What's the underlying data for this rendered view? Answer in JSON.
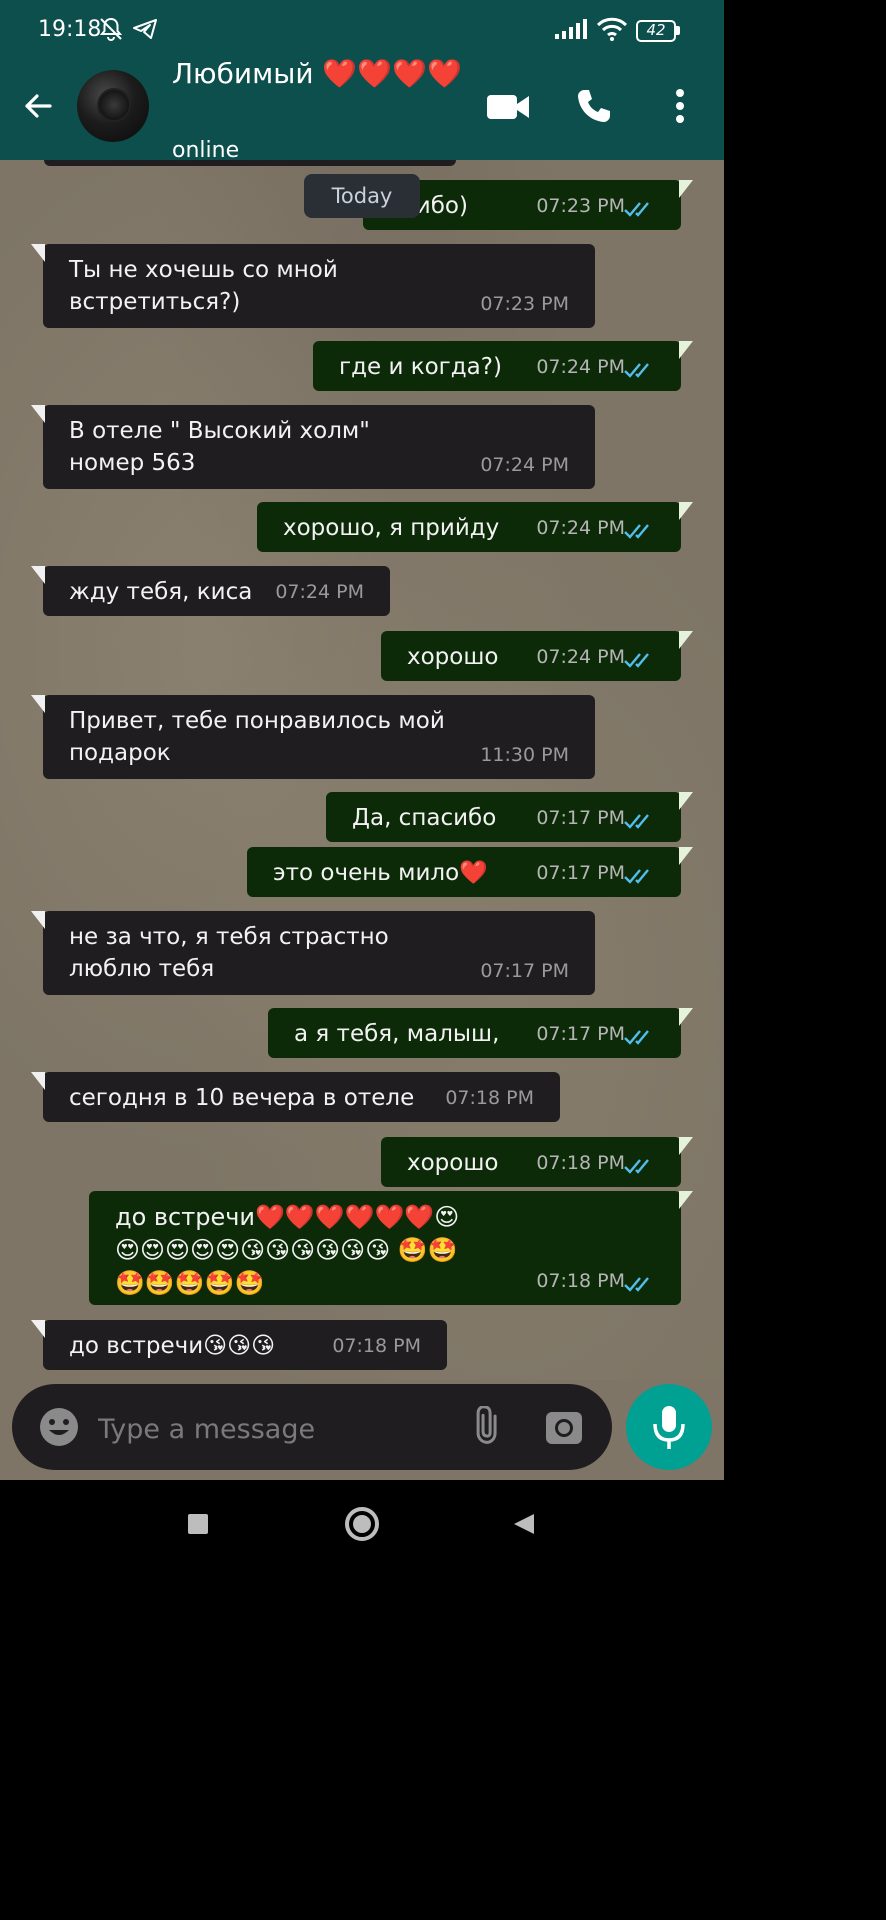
{
  "status_bar": {
    "time": "19:18",
    "battery": "42"
  },
  "header": {
    "contact_name": "Любимый ❤️❤️❤️❤️",
    "status": "online"
  },
  "chat": {
    "date_chip": "Today",
    "messages": [
      {
        "dir": "out",
        "text": "асибо)",
        "time": "07:23 PM"
      },
      {
        "dir": "in",
        "text": "Ты не хочешь со мной встретиться?)",
        "time": "07:23 PM"
      },
      {
        "dir": "out",
        "text": "где и когда?)",
        "time": "07:24 PM"
      },
      {
        "dir": "in",
        "text": "В отеле \" Высокий холм\" номер 563",
        "time": "07:24 PM"
      },
      {
        "dir": "out",
        "text": "хорошо, я прийду",
        "time": "07:24 PM"
      },
      {
        "dir": "in",
        "text": "жду тебя, киса",
        "time": "07:24 PM"
      },
      {
        "dir": "out",
        "text": "хорошо",
        "time": "07:24 PM"
      },
      {
        "dir": "in",
        "text": "Привет, тебе понравилось мой подарок",
        "time": "11:30 PM"
      },
      {
        "dir": "out",
        "text": "Да, спасибо",
        "time": "07:17 PM"
      },
      {
        "dir": "out",
        "text": "это очень мило❤️",
        "time": "07:17 PM"
      },
      {
        "dir": "in",
        "text": "не за что, я тебя страстно люблю тебя",
        "time": "07:17 PM"
      },
      {
        "dir": "out",
        "text": "а я тебя, малыш,",
        "time": "07:17 PM"
      },
      {
        "dir": "in",
        "text": "сегодня в 10 вечера в отеле",
        "time": "07:18 PM"
      },
      {
        "dir": "out",
        "text": "хорошо",
        "time": "07:18 PM"
      },
      {
        "dir": "out",
        "text": "до встречи❤️❤️❤️❤️❤️❤️😍 😍😍😍😍😍😘😘😘😘😘😘 🤩🤩🤩🤩🤩🤩🤩",
        "time": "07:18 PM"
      },
      {
        "dir": "in",
        "text": "до встречи😘😘😘",
        "time": "07:18 PM"
      }
    ]
  },
  "input": {
    "placeholder": "Type a message"
  },
  "icons": {
    "back": "arrow-left-icon",
    "video": "video-camera-icon",
    "call": "phone-icon",
    "menu": "more-vertical-icon",
    "emoji": "emoji-icon",
    "attach": "paperclip-icon",
    "camera": "camera-icon",
    "mic": "microphone-icon",
    "read": "double-check-icon"
  },
  "colors": {
    "header": "#0c4f4c",
    "incoming": "#1f1d20",
    "outgoing": "#0c2a08",
    "accent": "#00a092",
    "tick": "#53bdeb"
  }
}
